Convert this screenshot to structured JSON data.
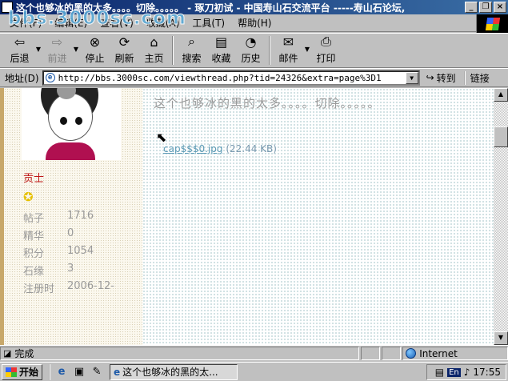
{
  "window": {
    "title": "这个也够冰的黑的太多。。。。切除。。。。。 - 琢刀初试 - 中国寿山石交流平台 -----寿山石论坛,",
    "watermark": "bbs.3000sc.com",
    "controls": [
      "_",
      "❐",
      "×"
    ]
  },
  "menu": {
    "items": [
      "文件(F)",
      "编辑(E)",
      "查看(V)",
      "收藏(A)",
      "工具(T)",
      "帮助(H)"
    ]
  },
  "toolbar": {
    "back": "后退",
    "forward": "前进",
    "stop": "停止",
    "refresh": "刷新",
    "home": "主页",
    "search": "搜索",
    "favorites": "收藏",
    "history": "历史",
    "mail": "邮件",
    "print": "打印"
  },
  "address": {
    "label": "地址(D)",
    "url": "http://bbs.3000sc.com/viewthread.php?tid=24326&extra=page%3D1",
    "go": "转到",
    "links": "链接"
  },
  "user": {
    "rank": "贡士",
    "stats": [
      {
        "label": "帖子",
        "value": "1716"
      },
      {
        "label": "精华",
        "value": "0"
      },
      {
        "label": "积分",
        "value": "1054"
      },
      {
        "label": "石缘",
        "value": "3"
      },
      {
        "label": "注册时",
        "value": "2006-12-"
      }
    ]
  },
  "post": {
    "title": "这个也够冰的黑的太多。。。。切除。。。。。",
    "attachment_name": "cap$$$0.jpg",
    "attachment_size": "(22.44 KB)"
  },
  "status": {
    "text": "完成",
    "zone": "Internet"
  },
  "taskbar": {
    "start": "开始",
    "task": "这个也够冰的黑的太...",
    "lang": "En",
    "time": "17:55"
  }
}
